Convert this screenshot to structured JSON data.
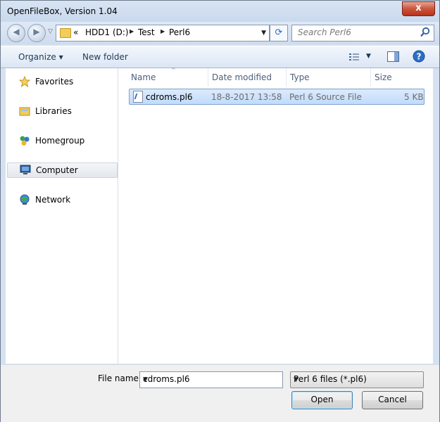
{
  "window": {
    "title": "OpenFileBox,  Version 1.04",
    "close_label": "x"
  },
  "address": {
    "recent_glyph": "▽",
    "overflow": "«",
    "crumbs": [
      "HDD1 (D:)",
      "Test",
      "Perl6"
    ],
    "dropdown_glyph": "▼",
    "refresh_glyph": "⟳"
  },
  "search": {
    "placeholder": "Search Perl6"
  },
  "toolbar": {
    "organize_label": "Organize ▾",
    "new_folder_label": "New folder",
    "views_dropdown_glyph": "▼"
  },
  "nav": {
    "items": [
      {
        "label": "Favorites",
        "icon": "star-icon",
        "selected": false
      },
      {
        "label": "Libraries",
        "icon": "libraries-icon",
        "selected": false
      },
      {
        "label": "Homegroup",
        "icon": "homegroup-icon",
        "selected": false
      },
      {
        "label": "Computer",
        "icon": "computer-icon",
        "selected": true
      },
      {
        "label": "Network",
        "icon": "network-icon",
        "selected": false
      }
    ]
  },
  "columns": {
    "name": "Name",
    "date": "Date modified",
    "type": "Type",
    "size": "Size",
    "sort_glyph": "^"
  },
  "files": [
    {
      "name": "cdroms.pl6",
      "date": "18-8-2017 13:58",
      "type": "Perl 6 Source File",
      "size": "5 KB"
    }
  ],
  "bottom": {
    "filename_label": "File name:",
    "filename_value": "cdroms.pl6",
    "filter_value": "Perl 6 files (*.pl6)",
    "dropdown_glyph": "▼",
    "open_label": "Open",
    "cancel_label": "Cancel"
  }
}
